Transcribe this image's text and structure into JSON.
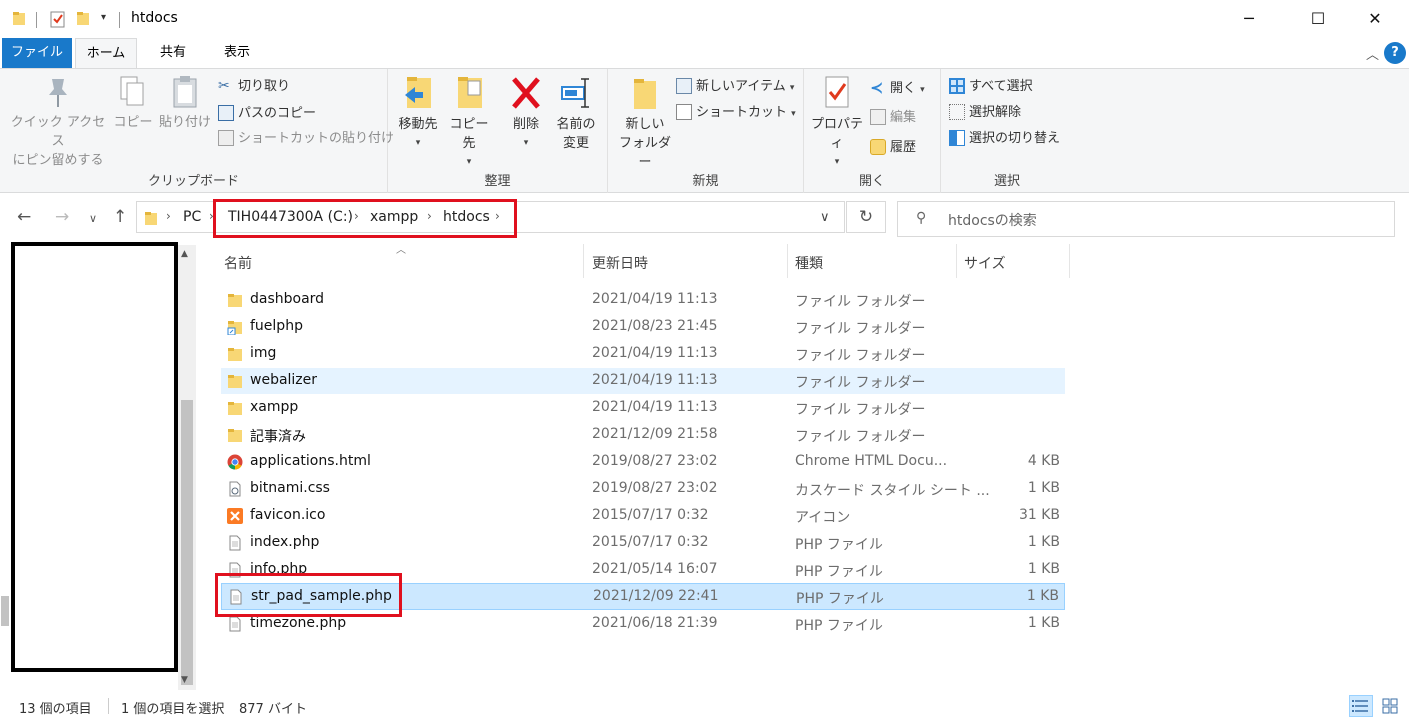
{
  "window": {
    "title": "htdocs",
    "minimize": "─",
    "maximize": "☐",
    "close": "✕"
  },
  "tabs": {
    "file": "ファイル",
    "home": "ホーム",
    "share": "共有",
    "view": "表示",
    "help": "?"
  },
  "ribbon": {
    "clipboard": {
      "label": "クリップボード",
      "pin_line1": "クイック アクセス",
      "pin_line2": "にピン留めする",
      "copy": "コピー",
      "paste": "貼り付け",
      "cut": "切り取り",
      "copy_path": "パスのコピー",
      "paste_shortcut": "ショートカットの貼り付け"
    },
    "organize": {
      "label": "整理",
      "move_to": "移動先",
      "copy_to": "コピー先",
      "delete": "削除",
      "rename_line1": "名前の",
      "rename_line2": "変更"
    },
    "new": {
      "label": "新規",
      "new_folder_line1": "新しい",
      "new_folder_line2": "フォルダー",
      "new_item": "新しいアイテム",
      "shortcut": "ショートカット"
    },
    "open": {
      "label": "開く",
      "properties": "プロパティ",
      "open": "開く",
      "edit": "編集",
      "history": "履歴"
    },
    "select": {
      "label": "選択",
      "select_all": "すべて選択",
      "select_none": "選択解除",
      "invert": "選択の切り替え"
    }
  },
  "address": {
    "crumbs": [
      "PC",
      "TIH0447300A (C:)",
      "xampp",
      "htdocs"
    ],
    "search_placeholder": "htdocsの検索"
  },
  "columns": {
    "name": "名前",
    "date": "更新日時",
    "type": "種類",
    "size": "サイズ"
  },
  "files": [
    {
      "name": "dashboard",
      "date": "2021/04/19 11:13",
      "type": "ファイル フォルダー",
      "size": "",
      "icon": "folder-icon"
    },
    {
      "name": "fuelphp",
      "date": "2021/08/23 21:45",
      "type": "ファイル フォルダー",
      "size": "",
      "icon": "folder-shortcut-icon"
    },
    {
      "name": "img",
      "date": "2021/04/19 11:13",
      "type": "ファイル フォルダー",
      "size": "",
      "icon": "folder-icon"
    },
    {
      "name": "webalizer",
      "date": "2021/04/19 11:13",
      "type": "ファイル フォルダー",
      "size": "",
      "icon": "folder-icon"
    },
    {
      "name": "xampp",
      "date": "2021/04/19 11:13",
      "type": "ファイル フォルダー",
      "size": "",
      "icon": "folder-icon"
    },
    {
      "name": "記事済み",
      "date": "2021/12/09 21:58",
      "type": "ファイル フォルダー",
      "size": "",
      "icon": "folder-icon"
    },
    {
      "name": "applications.html",
      "date": "2019/08/27 23:02",
      "type": "Chrome HTML Docu...",
      "size": "4 KB",
      "icon": "chrome-icon"
    },
    {
      "name": "bitnami.css",
      "date": "2019/08/27 23:02",
      "type": "カスケード スタイル シート ...",
      "size": "1 KB",
      "icon": "css-file-icon"
    },
    {
      "name": "favicon.ico",
      "date": "2015/07/17 0:32",
      "type": "アイコン",
      "size": "31 KB",
      "icon": "xampp-icon"
    },
    {
      "name": "index.php",
      "date": "2015/07/17 0:32",
      "type": "PHP ファイル",
      "size": "1 KB",
      "icon": "file-icon"
    },
    {
      "name": "info.php",
      "date": "2021/05/14 16:07",
      "type": "PHP ファイル",
      "size": "1 KB",
      "icon": "file-icon"
    },
    {
      "name": "str_pad_sample.php",
      "date": "2021/12/09 22:41",
      "type": "PHP ファイル",
      "size": "1 KB",
      "icon": "file-icon"
    },
    {
      "name": "timezone.php",
      "date": "2021/06/18 21:39",
      "type": "PHP ファイル",
      "size": "1 KB",
      "icon": "file-icon"
    }
  ],
  "status": {
    "count": "13 個の項目",
    "selection": "1 個の項目を選択",
    "size": "877 バイト"
  },
  "colors": {
    "accent": "#1979ca",
    "highlight": "#e0101e",
    "selection": "#cce8ff"
  }
}
